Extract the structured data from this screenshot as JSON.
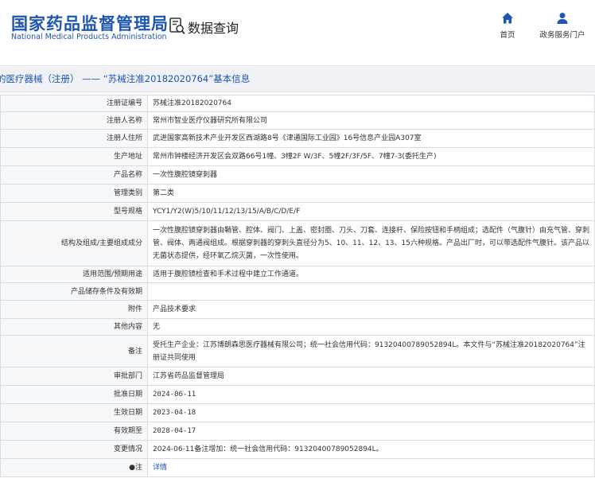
{
  "header": {
    "logo_cn": "国家药品监督管理局",
    "logo_en": "National Medical Products Administration",
    "query_label": "数据查询",
    "nav_home": "首页",
    "nav_service": "政务服务门户"
  },
  "title": "的医疗器械（注册） —— “苏械注准20182020764”基本信息",
  "rows": [
    {
      "label": "注册证编号",
      "value": "苏械注准20182020764"
    },
    {
      "label": "注册人名称",
      "value": "常州市智业医疗仪器研究所有限公司"
    },
    {
      "label": "注册人住所",
      "value": "武进国家高新技术产业开发区西湖路8号《津通国际工业园》16号信息产业园A307室"
    },
    {
      "label": "生产地址",
      "value": "常州市钟楼经济开发区会双路66号1幢、3幢2F W/3F、5幢2F/3F/5F、7幢7-3(委托生产)"
    },
    {
      "label": "产品名称",
      "value": "一次性腹腔镜穿刺器"
    },
    {
      "label": "管理类别",
      "value": "第二类"
    },
    {
      "label": "型号规格",
      "value": "YCY1/Y2(W)5/10/11/12/13/15/A/B/C/D/E/F"
    },
    {
      "label": "结构及组成/主要组成成分",
      "value": "一次性腹腔镜穿刺器由鞘管、腔体、阀门、上盖、密封圈、刀头、刀套、连接杆、保险按钮和手柄组成；选配件（气腹针）由充气管、穿刺管、阀体、两通阀组成。根据穿刺器的穿刺头直径分为5、10、11、12、13、15六种规格。产品出厂时，可以带选配件气腹针。该产品以无菌状态提供，经环氧乙烷灭菌，一次性使用。"
    },
    {
      "label": "适用范围/预期用途",
      "value": "适用于腹腔镜检查和手术过程中建立工作通道。"
    },
    {
      "label": "产品储存条件及有效期",
      "value": ""
    },
    {
      "label": "附件",
      "value": "产品技术要求"
    },
    {
      "label": "其他内容",
      "value": "无"
    },
    {
      "label": "备注",
      "value": "受托生产企业：江苏博朗森思医疗器械有限公司；统一社会信用代码：91320400789052894L。本文件与“苏械注准20182020764”注册证共同使用"
    },
    {
      "label": "审批部门",
      "value": "江苏省药品监督管理局"
    },
    {
      "label": "批准日期",
      "value": "2024-06-11"
    },
    {
      "label": "生效日期",
      "value": "2023-04-18"
    },
    {
      "label": "有效期至",
      "value": "2028-04-17"
    },
    {
      "label": "变更情况",
      "value": "2024-06-11备注增加：统一社会信用代码：91320400789052894L。"
    },
    {
      "label": "●注",
      "value": "详情"
    }
  ]
}
